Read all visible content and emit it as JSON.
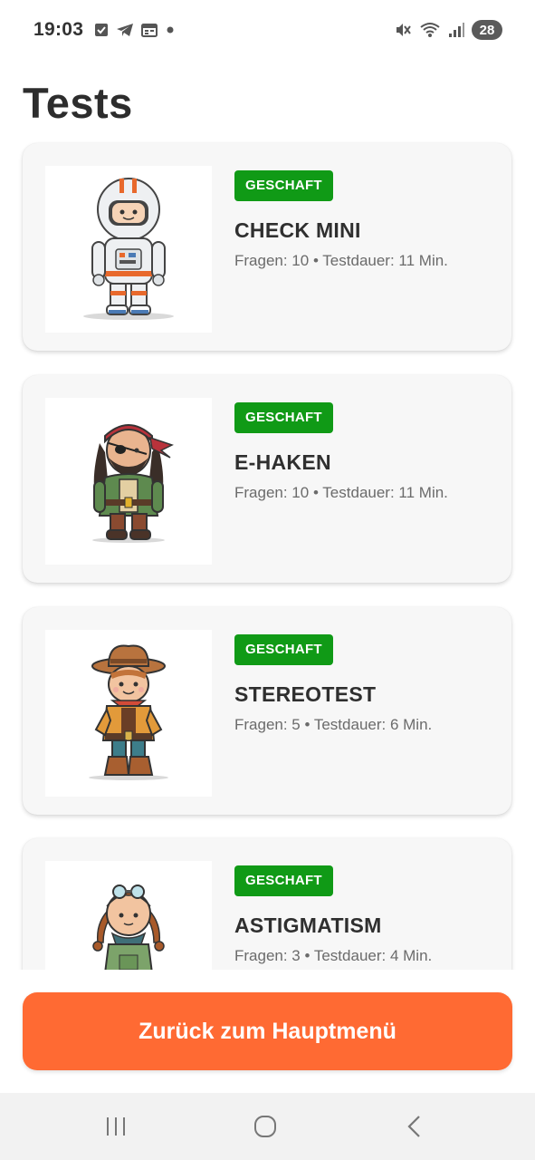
{
  "status_bar": {
    "time": "19:03",
    "left_icons": [
      "checkbox-icon",
      "telegram-icon",
      "calendar-icon",
      "dot-icon"
    ],
    "right_icons": [
      "mute-icon",
      "wifi-icon",
      "signal-icon"
    ],
    "battery": "28"
  },
  "page": {
    "title": "Tests"
  },
  "tests": [
    {
      "status": "GESCHAFT",
      "name": "CHECK MINI",
      "meta": "Fragen: 10 • Testdauer: 11 Min.",
      "avatar": "astronaut-avatar"
    },
    {
      "status": "GESCHAFT",
      "name": "E-HAKEN",
      "meta": "Fragen: 10 • Testdauer: 11 Min.",
      "avatar": "pirate-avatar"
    },
    {
      "status": "GESCHAFT",
      "name": "STEREOTEST",
      "meta": "Fragen: 5 • Testdauer: 6 Min.",
      "avatar": "cowboy-avatar"
    },
    {
      "status": "GESCHAFT",
      "name": "ASTIGMATISM",
      "meta": "Fragen: 3 • Testdauer: 4 Min.",
      "avatar": "aviator-girl-avatar"
    }
  ],
  "footer": {
    "back_label": "Zurück zum Hauptmenü"
  },
  "colors": {
    "accent": "#ff6a33",
    "badge": "#109a16",
    "card": "#f7f7f7"
  },
  "nav_bar": [
    "recents-icon",
    "home-icon",
    "back-icon"
  ]
}
